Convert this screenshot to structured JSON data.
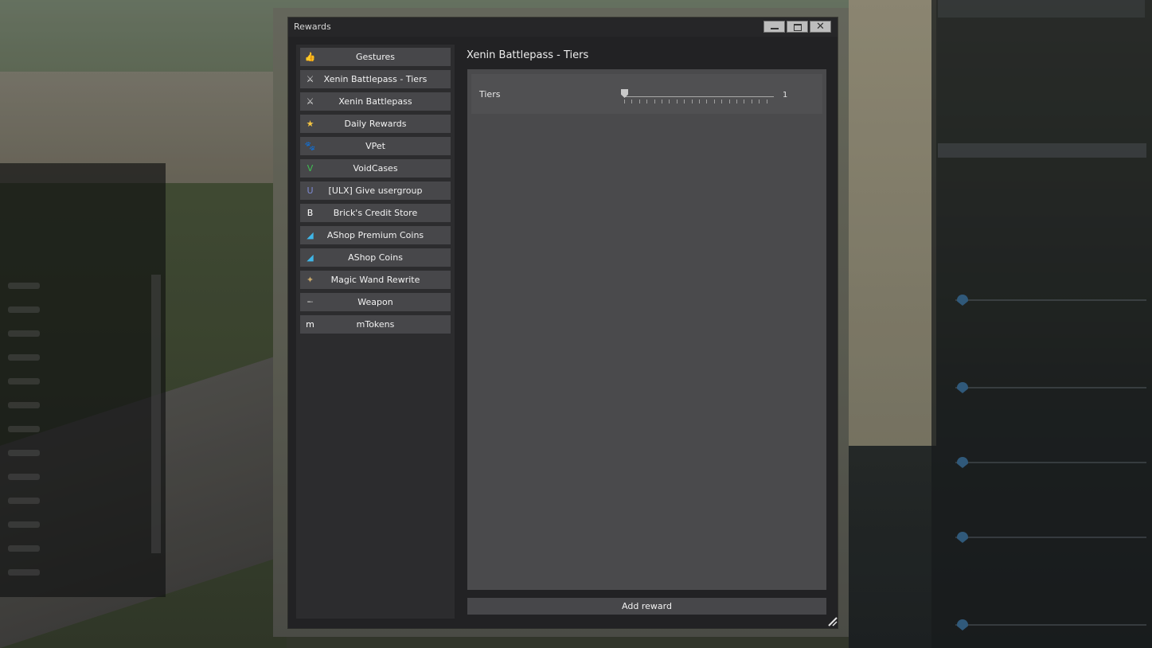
{
  "window": {
    "title": "Rewards",
    "close_glyph": "✕"
  },
  "sidebar": {
    "items": [
      {
        "label": "Gestures",
        "icon": "thumbs-up-icon",
        "glyph": "👍",
        "color": "#f5c518"
      },
      {
        "label": "Xenin Battlepass - Tiers",
        "icon": "crossed-swords-icon",
        "glyph": "⚔",
        "color": "#e0e0e0"
      },
      {
        "label": "Xenin Battlepass",
        "icon": "crossed-swords-icon",
        "glyph": "⚔",
        "color": "#e0e0e0"
      },
      {
        "label": "Daily Rewards",
        "icon": "star-icon",
        "glyph": "★",
        "color": "#f5c542"
      },
      {
        "label": "VPet",
        "icon": "paw-icon",
        "glyph": "🐾",
        "color": "#3a8df0"
      },
      {
        "label": "VoidCases",
        "icon": "voidcases-v-icon",
        "glyph": "V",
        "color": "#3fbf52"
      },
      {
        "label": "[ULX] Give usergroup",
        "icon": "ulx-u-icon",
        "glyph": "U",
        "color": "#7f8bd6"
      },
      {
        "label": "Brick's Credit Store",
        "icon": "bricks-b-icon",
        "glyph": "B",
        "color": "#ffffff"
      },
      {
        "label": "AShop Premium Coins",
        "icon": "ashop-premium-icon",
        "glyph": "◢",
        "color": "#3fb6e8"
      },
      {
        "label": "AShop Coins",
        "icon": "ashop-coins-icon",
        "glyph": "◢",
        "color": "#3fb6e8"
      },
      {
        "label": "Magic Wand Rewrite",
        "icon": "magic-wand-icon",
        "glyph": "✦",
        "color": "#c9a86a"
      },
      {
        "label": "Weapon",
        "icon": "gun-icon",
        "glyph": "╾",
        "color": "#9a9a9a"
      },
      {
        "label": "mTokens",
        "icon": "mtokens-m-icon",
        "glyph": "m",
        "color": "#ffffff"
      }
    ]
  },
  "main": {
    "title": "Xenin Battlepass - Tiers",
    "setting": {
      "label": "Tiers",
      "value": "1"
    },
    "add_button": "Add reward"
  }
}
